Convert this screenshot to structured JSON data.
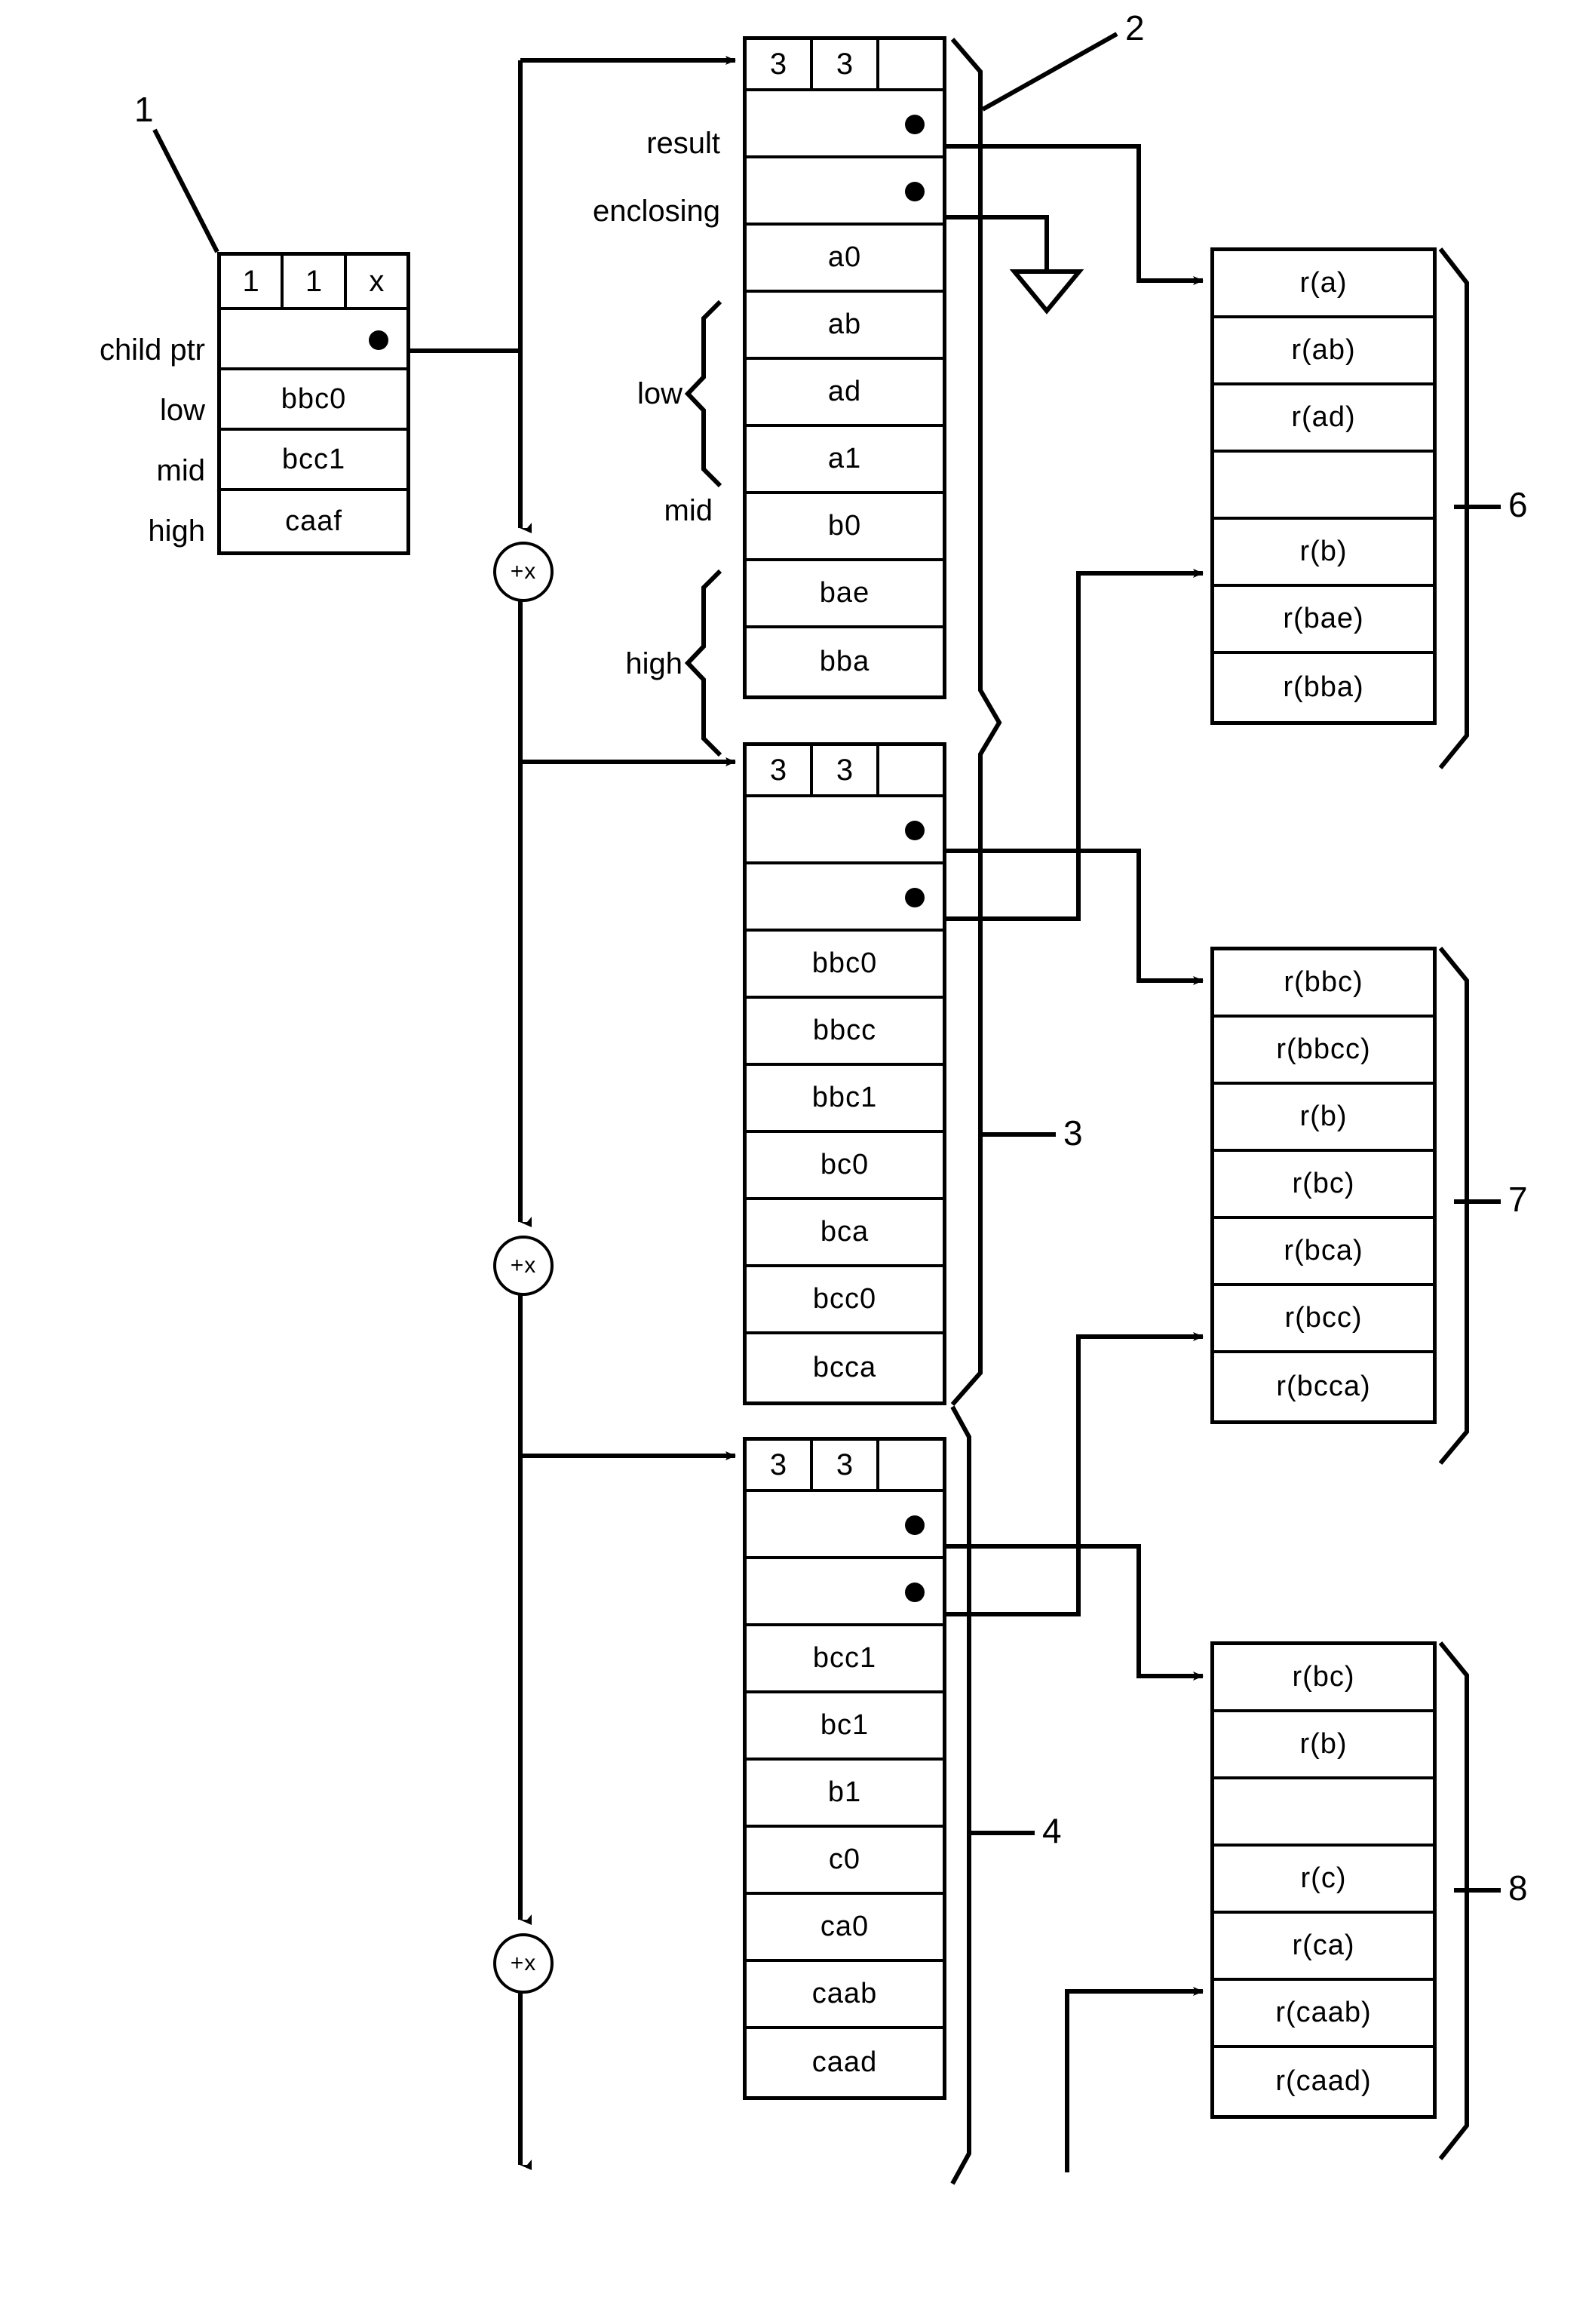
{
  "figure": {
    "ref_labels": [
      "1",
      "2",
      "3",
      "4",
      "6",
      "7",
      "8"
    ],
    "operator_label": "+x"
  },
  "node1": {
    "ref": "1",
    "header": [
      "1",
      "1",
      "x"
    ],
    "row_labels": [
      "child ptr",
      "low",
      "mid",
      "high"
    ],
    "rows": [
      {
        "label": "child ptr",
        "value": "",
        "pointer": true
      },
      {
        "label": "low",
        "value": "bbc0",
        "pointer": false
      },
      {
        "label": "mid",
        "value": "bcc1",
        "pointer": false
      },
      {
        "label": "high",
        "value": "caaf",
        "pointer": false
      }
    ]
  },
  "block2": {
    "ref": "2",
    "header": [
      "3",
      "3",
      ""
    ],
    "rows": [
      {
        "label": "result",
        "value": "",
        "pointer": true
      },
      {
        "label": "enclosing",
        "value": "",
        "pointer": true
      },
      {
        "label": "",
        "value": "a0",
        "pointer": false
      },
      {
        "label": "",
        "value": "ab",
        "pointer": false
      },
      {
        "label": "",
        "value": "ad",
        "pointer": false
      },
      {
        "label": "",
        "value": "a1",
        "pointer": false
      },
      {
        "label": "",
        "value": "b0",
        "pointer": false
      },
      {
        "label": "",
        "value": "bae",
        "pointer": false
      },
      {
        "label": "",
        "value": "bba",
        "pointer": false
      }
    ],
    "group_labels": {
      "low": "low",
      "mid": "mid",
      "high": "high"
    },
    "result_label": "result",
    "enclosing_label": "enclosing"
  },
  "block3": {
    "ref": "3",
    "header": [
      "3",
      "3",
      ""
    ],
    "rows": [
      {
        "value": "",
        "pointer": true
      },
      {
        "value": "",
        "pointer": true
      },
      {
        "value": "bbc0",
        "pointer": false
      },
      {
        "value": "bbcc",
        "pointer": false
      },
      {
        "value": "bbc1",
        "pointer": false
      },
      {
        "value": "bc0",
        "pointer": false
      },
      {
        "value": "bca",
        "pointer": false
      },
      {
        "value": "bcc0",
        "pointer": false
      },
      {
        "value": "bcca",
        "pointer": false
      }
    ]
  },
  "block4": {
    "ref": "4",
    "header": [
      "3",
      "3",
      ""
    ],
    "rows": [
      {
        "value": "",
        "pointer": true
      },
      {
        "value": "",
        "pointer": true
      },
      {
        "value": "bcc1",
        "pointer": false
      },
      {
        "value": "bc1",
        "pointer": false
      },
      {
        "value": "b1",
        "pointer": false
      },
      {
        "value": "c0",
        "pointer": false
      },
      {
        "value": "ca0",
        "pointer": false
      },
      {
        "value": "caab",
        "pointer": false
      },
      {
        "value": "caad",
        "pointer": false
      }
    ]
  },
  "block6": {
    "ref": "6",
    "rows": [
      {
        "value": "r(a)",
        "empty": false
      },
      {
        "value": "r(ab)",
        "empty": false
      },
      {
        "value": "r(ad)",
        "empty": false
      },
      {
        "value": "",
        "empty": true
      },
      {
        "value": "r(b)",
        "empty": false
      },
      {
        "value": "r(bae)",
        "empty": false
      },
      {
        "value": "r(bba)",
        "empty": false
      }
    ]
  },
  "block7": {
    "ref": "7",
    "rows": [
      {
        "value": "r(bbc)",
        "empty": false
      },
      {
        "value": "r(bbcc)",
        "empty": false
      },
      {
        "value": "r(b)",
        "empty": false
      },
      {
        "value": "r(bc)",
        "empty": false
      },
      {
        "value": "r(bca)",
        "empty": false
      },
      {
        "value": "r(bcc)",
        "empty": false
      },
      {
        "value": "r(bcca)",
        "empty": false
      }
    ]
  },
  "block8": {
    "ref": "8",
    "rows": [
      {
        "value": "r(bc)",
        "empty": false
      },
      {
        "value": "r(b)",
        "empty": false
      },
      {
        "value": "",
        "empty": true
      },
      {
        "value": "r(c)",
        "empty": false
      },
      {
        "value": "r(ca)",
        "empty": false
      },
      {
        "value": "r(caab)",
        "empty": false
      },
      {
        "value": "r(caad)",
        "empty": false
      }
    ]
  },
  "operators": [
    {
      "label": "+x"
    },
    {
      "label": "+x"
    },
    {
      "label": "+x"
    }
  ]
}
